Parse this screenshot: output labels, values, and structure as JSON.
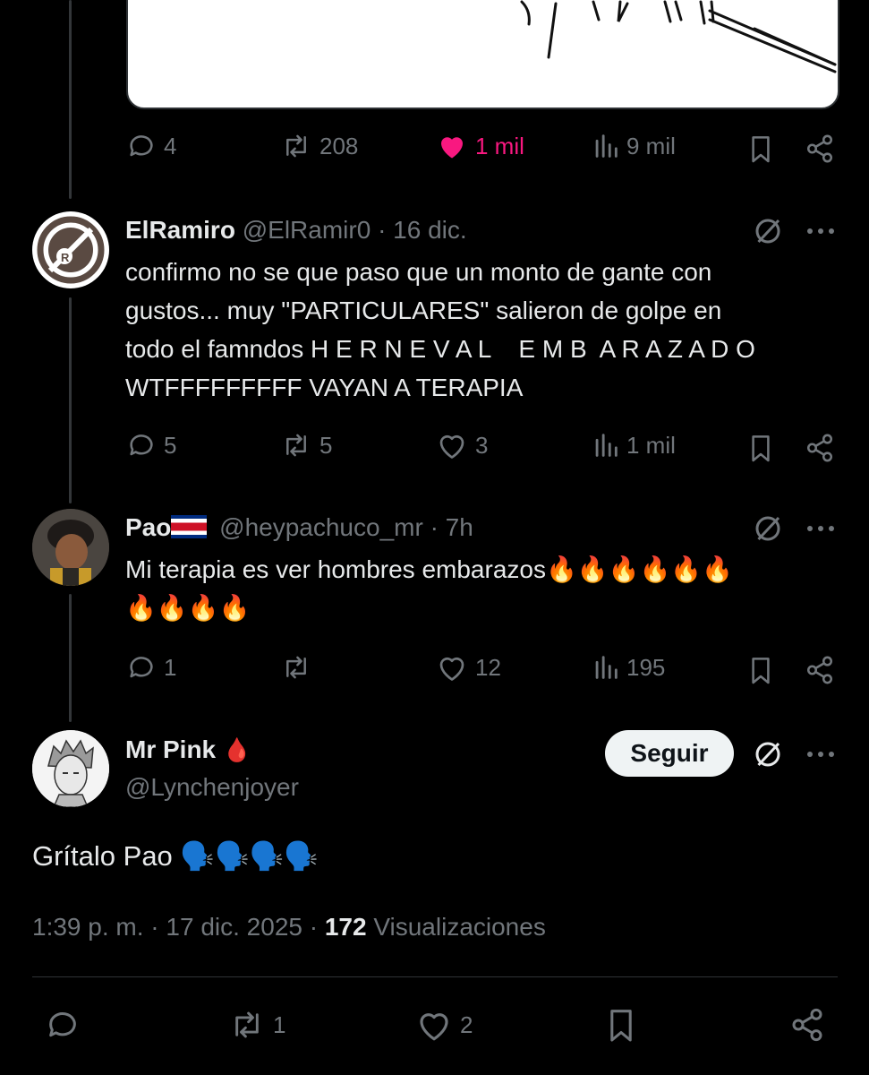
{
  "quoted_post": {
    "stats": {
      "replies": "4",
      "reposts": "208",
      "likes": "1 mil",
      "views": "9 mil"
    }
  },
  "replies": [
    {
      "display_name": "ElRamiro",
      "handle": "@ElRamir0",
      "time": "· 16 dic.",
      "lines": [
        "confirmo no se que paso que un monto de gante con",
        "gustos... muy \"PARTICULARES\" salieron de golpe en",
        "todo el famndos H E R N E V A L    E M B  A R A Z A D O",
        "WTFFFFFFFFF VAYAN A TERAPIA"
      ],
      "stats": {
        "replies": "5",
        "reposts": "5",
        "likes": "3",
        "views": "1 mil"
      }
    },
    {
      "display_name": "Pao",
      "handle": "@heypachuco_mr",
      "time": "· 7h",
      "lines": [
        "Mi terapia es ver hombres embarazos🔥🔥🔥🔥🔥🔥",
        "🔥🔥🔥🔥"
      ],
      "stats": {
        "replies": "1",
        "reposts": "",
        "likes": "12",
        "views": "195"
      }
    }
  ],
  "main_post": {
    "display_name": "Mr Pink",
    "name_emoji": "🩸",
    "handle": "@Lynchenjoyer",
    "follow_label": "Seguir",
    "text": "Grítalo Pao 🗣️🗣️🗣️🗣️",
    "timestamp": "1:39 p. m. · 17 dic. 2025 · ",
    "views_count": "172",
    "views_label": " Visualizaciones",
    "stats": {
      "reposts": "1",
      "likes": "2"
    }
  },
  "colors": {
    "background": "#000000",
    "text": "#e7e9ea",
    "muted": "#71767b",
    "like_active": "#f91880",
    "follow_bg": "#eff3f4"
  }
}
